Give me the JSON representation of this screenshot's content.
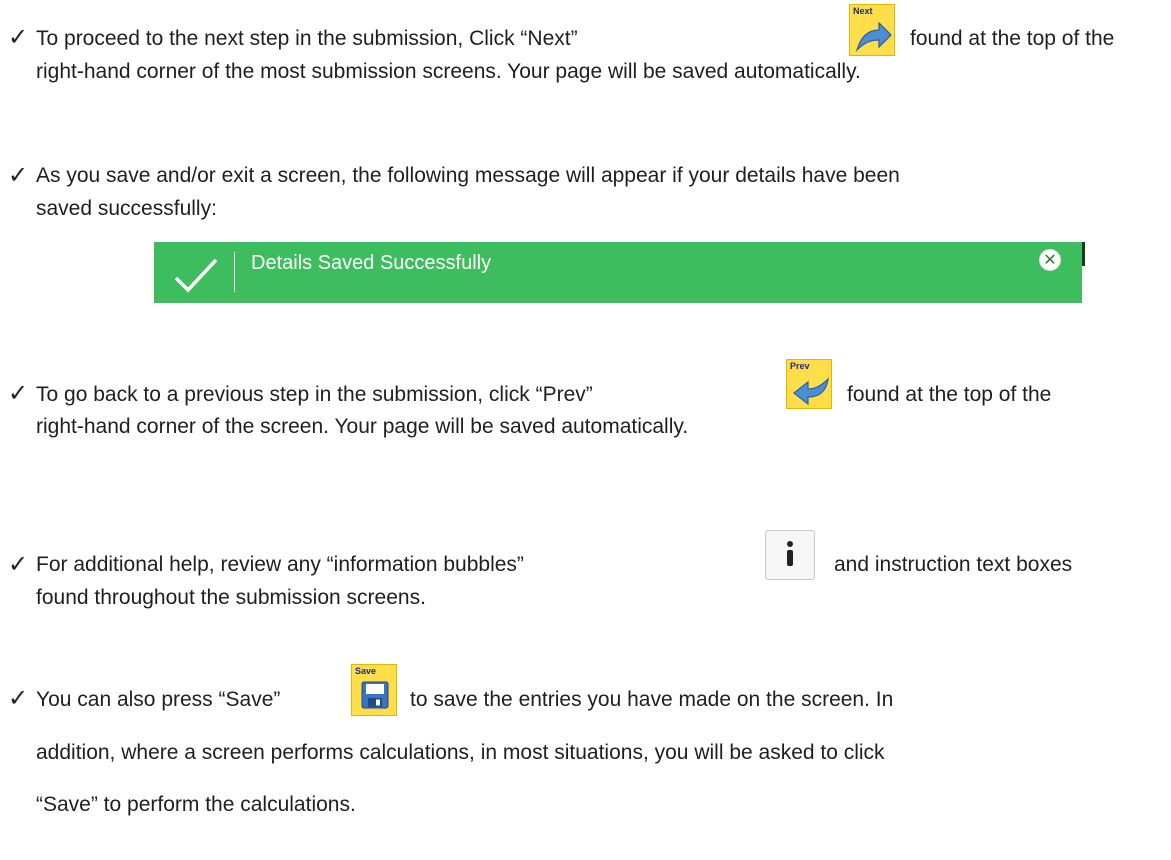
{
  "items": [
    {
      "check": "✓",
      "lines": [
        "To proceed to the next step in the submission, Click “Next”",
        "found at the top of the",
        "right-hand corner of the most submission screens.  Your page will be saved automatically."
      ],
      "icon": {
        "name": "next-arrow-icon",
        "label": "Next"
      }
    },
    {
      "check": "✓",
      "lines": [
        "As you save and/or exit a screen, the following message will appear if your details have been",
        "saved successfully:"
      ],
      "banner": {
        "text": "Details Saved Successfully",
        "icon": "checkmark-icon",
        "close_icon": "close-icon",
        "color": "#3dbd5d"
      }
    },
    {
      "check": "✓",
      "lines": [
        "To go back to a previous step in the submission, click “Prev”",
        "found at the top of the",
        "right-hand corner of the screen.  Your page will be saved automatically."
      ],
      "icon": {
        "name": "prev-arrow-icon",
        "label": "Prev"
      }
    },
    {
      "check": "✓",
      "lines": [
        "For additional help, review any “information bubbles”",
        "and instruction text boxes",
        "found throughout the submission screens."
      ],
      "icon": {
        "name": "info-icon",
        "label": "i"
      }
    },
    {
      "check": "✓",
      "lines": [
        "You can also press “Save”",
        "to save the entries you have made on the screen.  In",
        "addition, where a screen performs calculations, in most situations, you will be asked to click",
        "“Save” to perform the calculations."
      ],
      "icon": {
        "name": "save-floppy-icon",
        "label": "Save"
      }
    }
  ],
  "colors": {
    "icon_tile": "#ffde4a",
    "banner": "#3dbd5d",
    "arrow": "#4a8fd6"
  }
}
